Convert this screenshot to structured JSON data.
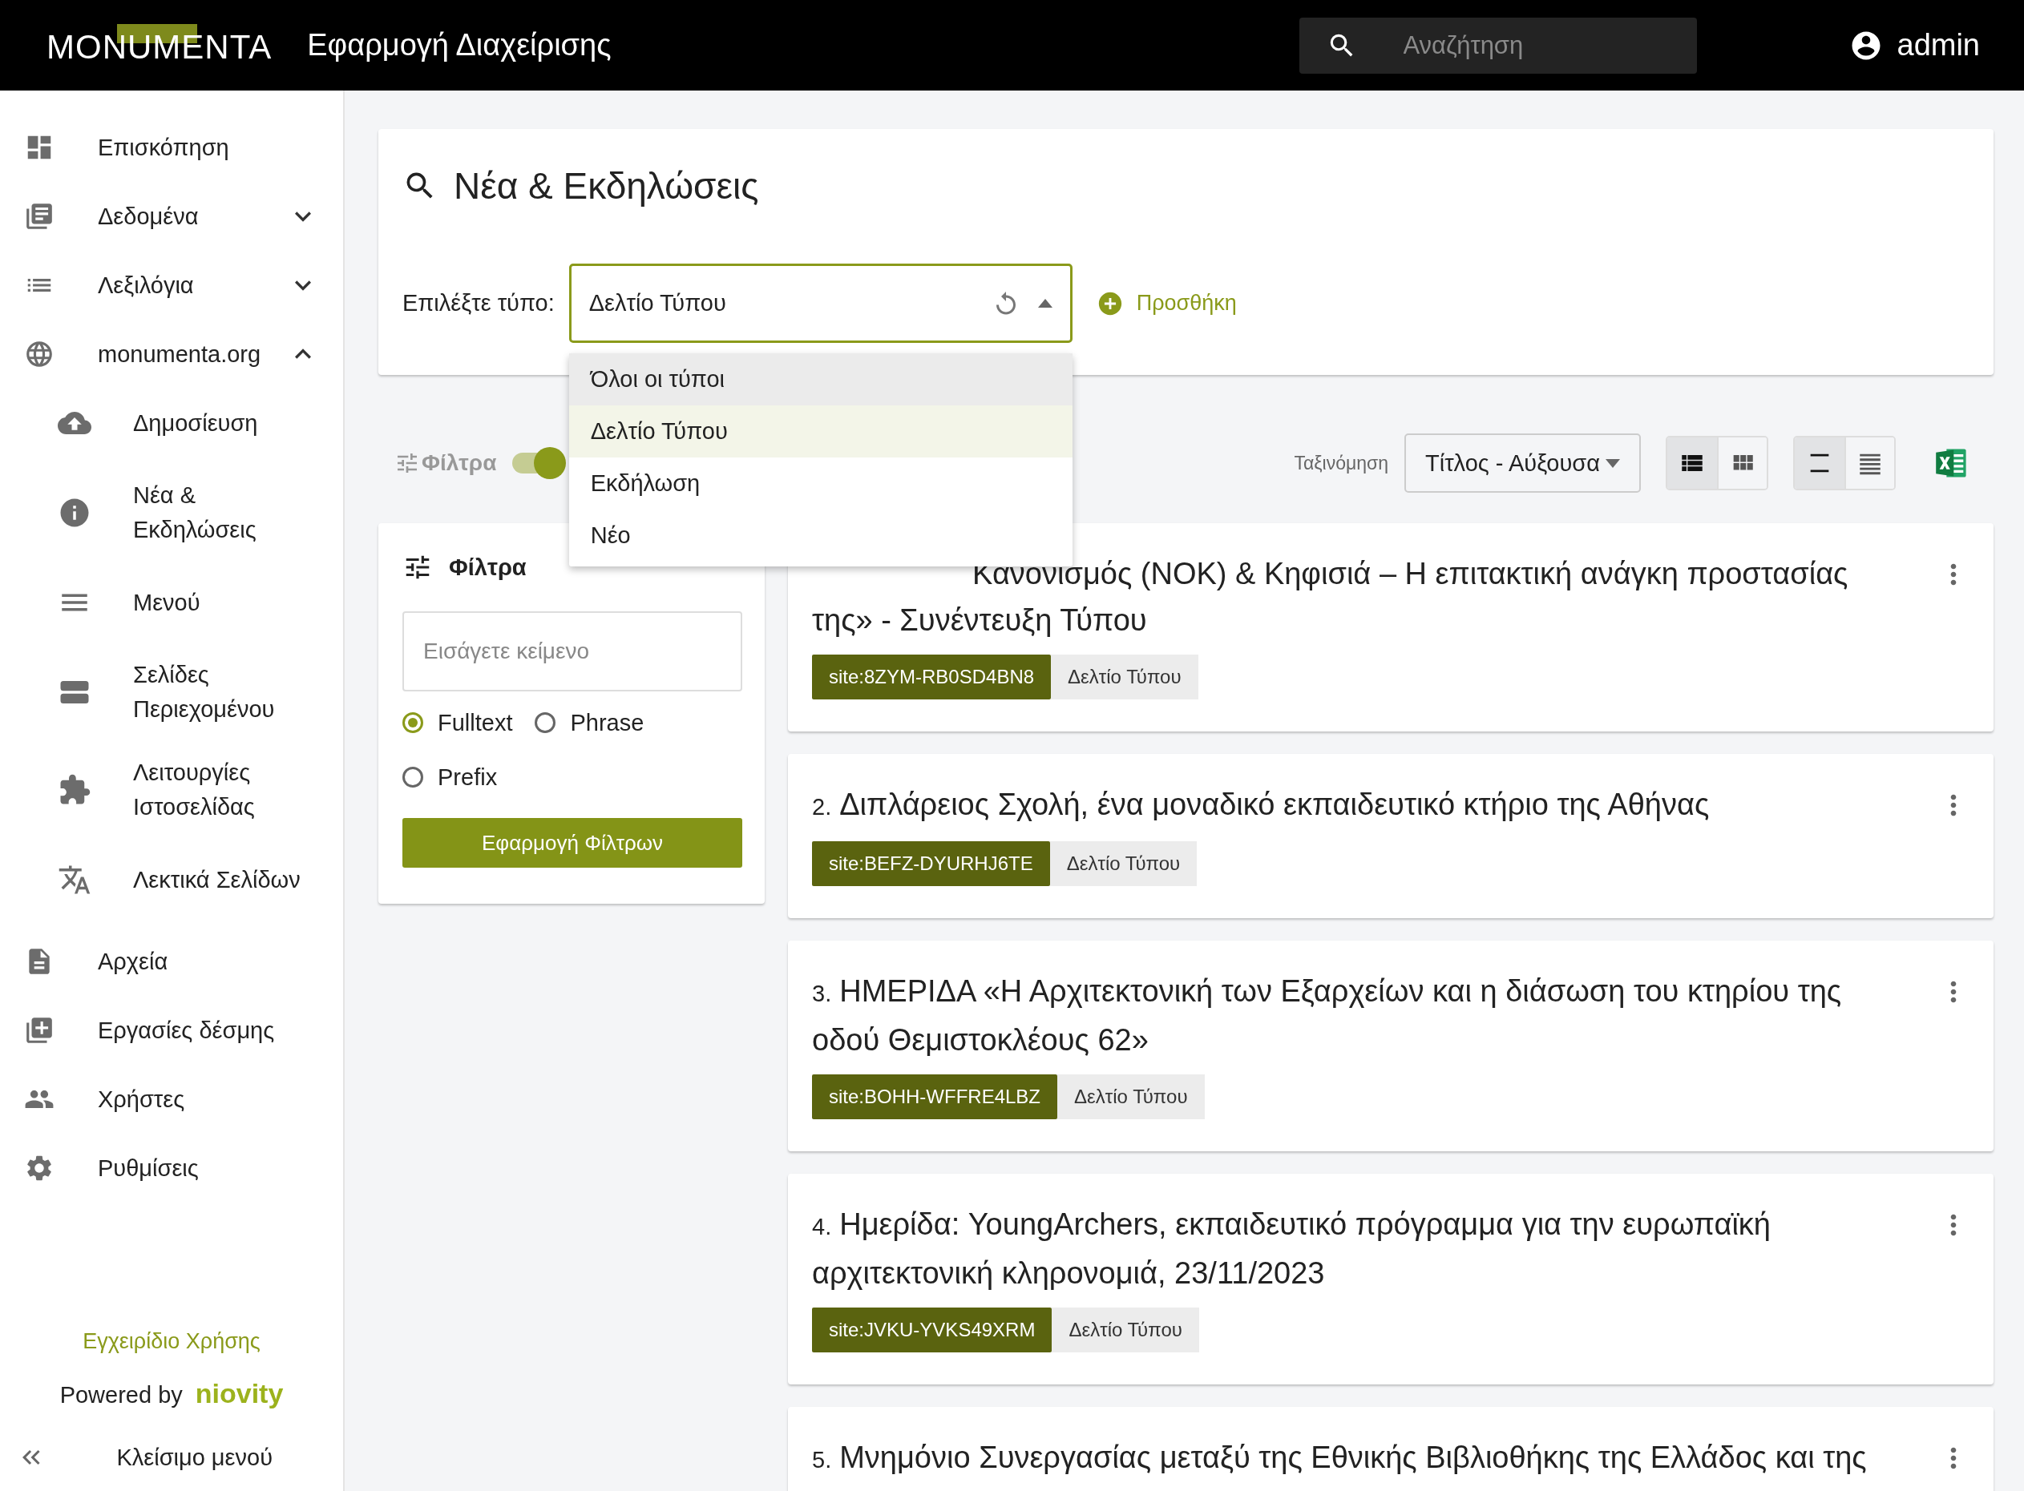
{
  "header": {
    "logo": "MONUMENTA",
    "app_title": "Εφαρμογή Διαχείρισης",
    "search": {
      "placeholder": "Αναζήτηση"
    },
    "user": "admin"
  },
  "sidebar": {
    "items": [
      {
        "label": "Επισκόπηση",
        "kind": "link"
      },
      {
        "label": "Δεδομένα",
        "kind": "group",
        "expanded": false
      },
      {
        "label": "Λεξιλόγια",
        "kind": "group",
        "expanded": false
      },
      {
        "label": "monumenta.org",
        "kind": "group",
        "expanded": true,
        "children": [
          {
            "label": "Δημοσίευση"
          },
          {
            "label": "Νέα & Εκδηλώσεις"
          },
          {
            "label": "Μενού"
          },
          {
            "label": "Σελίδες Περιεχομένου"
          },
          {
            "label": "Λειτουργίες Ιστοσελίδας"
          },
          {
            "label": "Λεκτικά Σελίδων"
          }
        ]
      },
      {
        "label": "Αρχεία",
        "kind": "link"
      },
      {
        "label": "Εργασίες δέσμης",
        "kind": "link"
      },
      {
        "label": "Χρήστες",
        "kind": "link"
      },
      {
        "label": "Ρυθμίσεις",
        "kind": "link"
      }
    ],
    "manual_link": "Εγχειρίδιο Χρήσης",
    "powered_by": "Powered by",
    "brand": "niovity",
    "collapse_label": "Κλείσιμο μενού"
  },
  "page": {
    "title": "Νέα & Εκδηλώσεις",
    "type_label": "Επιλέξτε τύπο:",
    "type_select": {
      "value": "Δελτίο Τύπου",
      "open": true,
      "options": [
        {
          "label": "Όλοι οι τύποι",
          "selected": false,
          "hovered": true
        },
        {
          "label": "Δελτίο Τύπου",
          "selected": true,
          "hovered": false
        },
        {
          "label": "Εκδήλωση",
          "selected": false,
          "hovered": false
        },
        {
          "label": "Νέο",
          "selected": false,
          "hovered": false
        }
      ]
    },
    "add_button": "Προσθήκη"
  },
  "toolbar": {
    "filters_label": "Φίλτρα",
    "filters_on": true,
    "sort_label": "Ταξινόμηση",
    "sort_value": "Τίτλος - Αύξουσα",
    "layouts": [
      {
        "kind": "list",
        "selected": true
      },
      {
        "kind": "grid",
        "selected": false
      }
    ],
    "densities": [
      {
        "kind": "spaced",
        "selected": true
      },
      {
        "kind": "dense",
        "selected": false
      }
    ]
  },
  "filters": {
    "title": "Φίλτρα",
    "search": {
      "placeholder": "Εισάγετε κείμενο"
    },
    "modes": [
      {
        "label": "Fulltext",
        "selected": true
      },
      {
        "label": "Phrase",
        "selected": false
      },
      {
        "label": "Prefix",
        "selected": false
      }
    ],
    "apply": "Εφαρμογή Φίλτρων"
  },
  "results": [
    {
      "title": "Κανονισμός (ΝΟΚ) & Κηφισιά – Η επιτακτική ανάγκη προστασίας της» - Συνέντευξη Τύπου",
      "site_id": "site:8ZYM-RB0SD4BN8",
      "type": "Δελτίο Τύπου"
    },
    {
      "number": "2.",
      "title": "Διπλάρειος Σχολή, ένα μοναδικό εκπαιδευτικό κτήριο της Αθήνας",
      "site_id": "site:BEFZ-DYURHJ6TE",
      "type": "Δελτίο Τύπου"
    },
    {
      "number": "3.",
      "title": "ΗΜΕΡΙΔΑ «Η Αρχιτεκτονική των Εξαρχείων και η διάσωση του κτηρίου της οδού Θεμιστοκλέους 62»",
      "site_id": "site:BOHH-WFFRE4LBZ",
      "type": "Δελτίο Τύπου"
    },
    {
      "number": "4.",
      "title": "Ημερίδα: YoungArchers, εκπαιδευτικό πρόγραμμα για την ευρωπαϊκή αρχιτεκτονική κληρονομιά, 23/11/2023",
      "site_id": "site:JVKU-YVKS49XRM",
      "type": "Δελτίο Τύπου"
    },
    {
      "number": "5.",
      "title": "Μνημόνιο Συνεργασίας μεταξύ της Εθνικής Βιβλιοθήκης της Ελλάδος και της"
    }
  ]
}
